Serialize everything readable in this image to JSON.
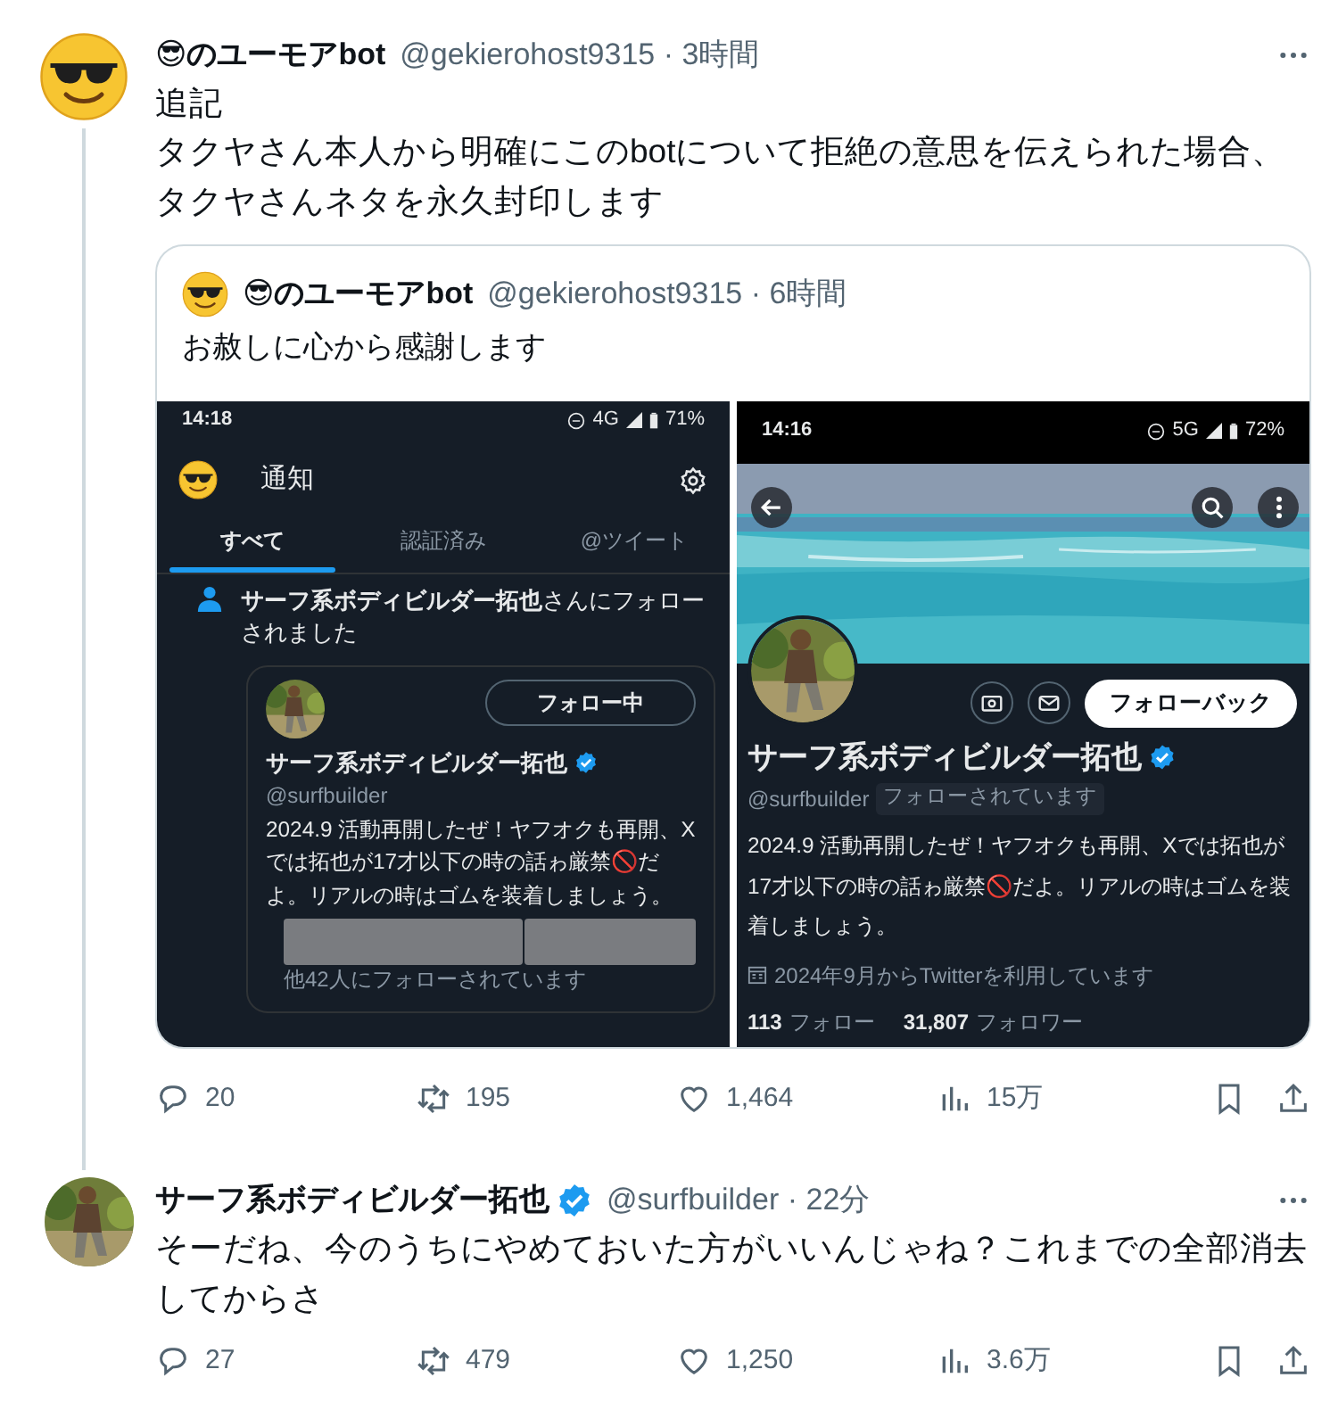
{
  "tweets": [
    {
      "avatar": {
        "kind": "emoji"
      },
      "name": "😎のユーモアbot",
      "verified": false,
      "meta": "@gekierohost9315 · 3時間",
      "thread_line": true,
      "text": [
        "追記",
        "タクヤさん本人から明確にこのbotについて拒絶の意思を伝えられた場合、タクヤさんネタを永久封印します"
      ],
      "quote": {
        "avatar": {
          "kind": "emoji"
        },
        "name": "😎のユーモアbot",
        "meta": "@gekierohost9315 · 6時間",
        "text": "お赦しに心から感謝します",
        "screenshots": [
          {
            "kind": "notifications",
            "status": {
              "time": "14:18",
              "network": "4G",
              "battery": "71%"
            },
            "title": "通知",
            "tabs": [
              {
                "label": "すべて",
                "selected": true
              },
              {
                "label": "認証済み",
                "selected": false
              },
              {
                "label": "@ツイート",
                "selected": false
              }
            ],
            "notification": "**サーフ系ボディビルダー拓也**さんにフォローされました",
            "user_card": {
              "follow_button": "フォロー中",
              "name": "サーフ系ボディビルダー拓也",
              "verified": true,
              "handle": "@surfbuilder",
              "bio": "2024.9 活動再開したぜ！ヤフオクも再開、Xでは拓也が17才以下の時の話ゎ厳禁🚫だよ。リアルの時はゴムを装着しましょう。",
              "redacted": true,
              "followed_by": "他42人にフォローされています"
            }
          },
          {
            "kind": "profile",
            "status": {
              "time": "14:16",
              "network": "5G",
              "battery": "72%"
            },
            "follow_button": "フォローバック",
            "name": "サーフ系ボディビルダー拓也",
            "verified": true,
            "handle": "@surfbuilder",
            "follows_you": "フォローされています",
            "bio": "2024.9 活動再開したぜ！ヤフオクも再開、Xでは拓也が17才以下の時の話ゎ厳禁🚫だよ。リアルの時はゴムを装着しましょう。",
            "joined": "2024年9月からTwitterを利用しています",
            "following_count": "113",
            "following_label": "フォロー",
            "followers_count": "31,807",
            "followers_label": "フォロワー"
          }
        ]
      },
      "actions": {
        "replies": "20",
        "reposts": "195",
        "likes": "1,464",
        "views": "15万"
      }
    },
    {
      "avatar": {
        "kind": "picture"
      },
      "name": "サーフ系ボディビルダー拓也",
      "verified": true,
      "meta": "@surfbuilder · 22分",
      "thread_line": false,
      "text": [
        "そーだね、今のうちにやめておいた方がいいんじゃね？これまでの全部消去してからさ"
      ],
      "actions": {
        "replies": "27",
        "reposts": "479",
        "likes": "1,250",
        "views": "3.6万"
      }
    }
  ]
}
